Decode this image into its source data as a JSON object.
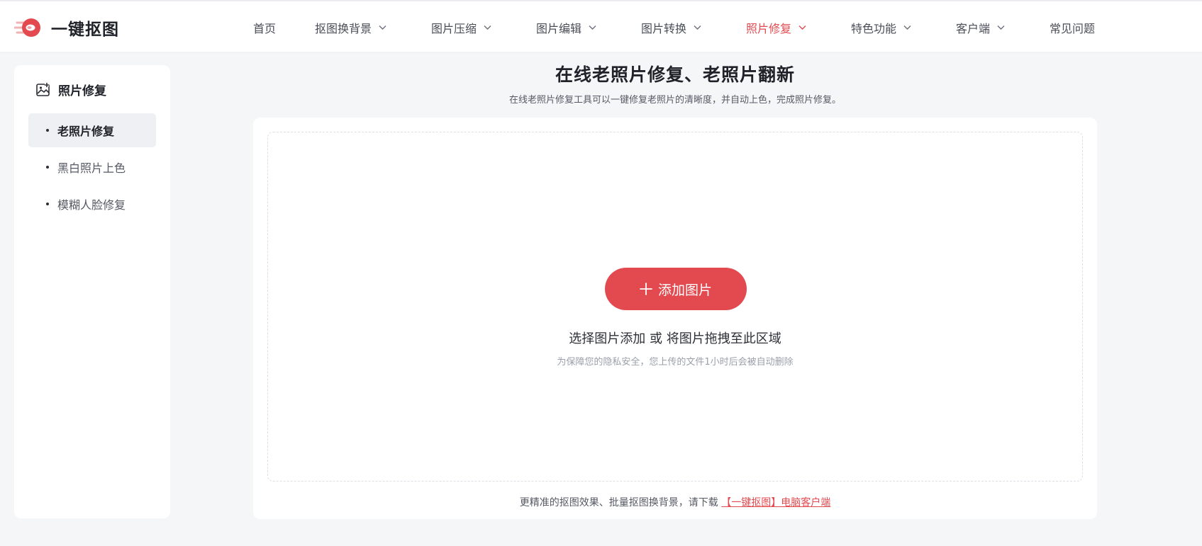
{
  "brand": {
    "name": "一键抠图",
    "accent_color": "#e24a4f"
  },
  "nav": {
    "items": [
      {
        "label": "首页",
        "has_dropdown": false
      },
      {
        "label": "抠图换背景",
        "has_dropdown": true
      },
      {
        "label": "图片压缩",
        "has_dropdown": true
      },
      {
        "label": "图片编辑",
        "has_dropdown": true
      },
      {
        "label": "图片转换",
        "has_dropdown": true
      },
      {
        "label": "照片修复",
        "has_dropdown": true,
        "active": true
      },
      {
        "label": "特色功能",
        "has_dropdown": true
      },
      {
        "label": "客户端",
        "has_dropdown": true
      },
      {
        "label": "常见问题",
        "has_dropdown": false
      }
    ]
  },
  "sidebar": {
    "title": "照片修复",
    "title_icon": "image-edit-icon",
    "items": [
      {
        "label": "老照片修复",
        "active": true
      },
      {
        "label": "黑白照片上色",
        "active": false
      },
      {
        "label": "模糊人脸修复",
        "active": false
      }
    ]
  },
  "main": {
    "title": "在线老照片修复、老照片翻新",
    "subtitle": "在线老照片修复工具可以一键修复老照片的清晰度，并自动上色，完成照片修复。",
    "upload": {
      "button_label": "添加图片",
      "button_icon": "plus-icon",
      "hint": "选择图片添加 或 将图片拖拽至此区域",
      "privacy_note": "为保障您的隐私安全，您上传的文件1小时后会被自动删除"
    },
    "footer": {
      "text": "更精准的抠图效果、批量抠图换背景，请下载",
      "link_label": "【一键抠图】电脑客户端"
    }
  }
}
